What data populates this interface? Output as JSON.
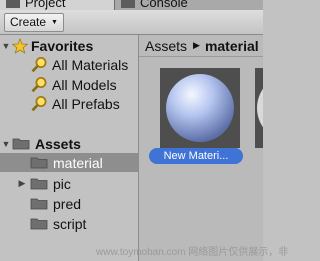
{
  "tabs": [
    {
      "label": "Project"
    },
    {
      "label": "Console"
    }
  ],
  "toolbar": {
    "create_label": "Create",
    "create_caret": "▼"
  },
  "favorites": {
    "label": "Favorites",
    "items": [
      {
        "label": "All Materials"
      },
      {
        "label": "All Models"
      },
      {
        "label": "All Prefabs"
      }
    ]
  },
  "assets": {
    "label": "Assets",
    "folders": [
      {
        "label": "material",
        "selected": true
      },
      {
        "label": "pic"
      },
      {
        "label": "pred"
      },
      {
        "label": "script"
      }
    ]
  },
  "breadcrumb": {
    "root": "Assets",
    "separator": "▶",
    "current": "material"
  },
  "items": [
    {
      "label": "New Materi..."
    }
  ],
  "watermark": "www.toymoban.com 网络图片仅供展示，非",
  "colors": {
    "selection": "#3f73d6",
    "selected_row": "#8e8e8e",
    "panel": "#c2c2c2"
  }
}
